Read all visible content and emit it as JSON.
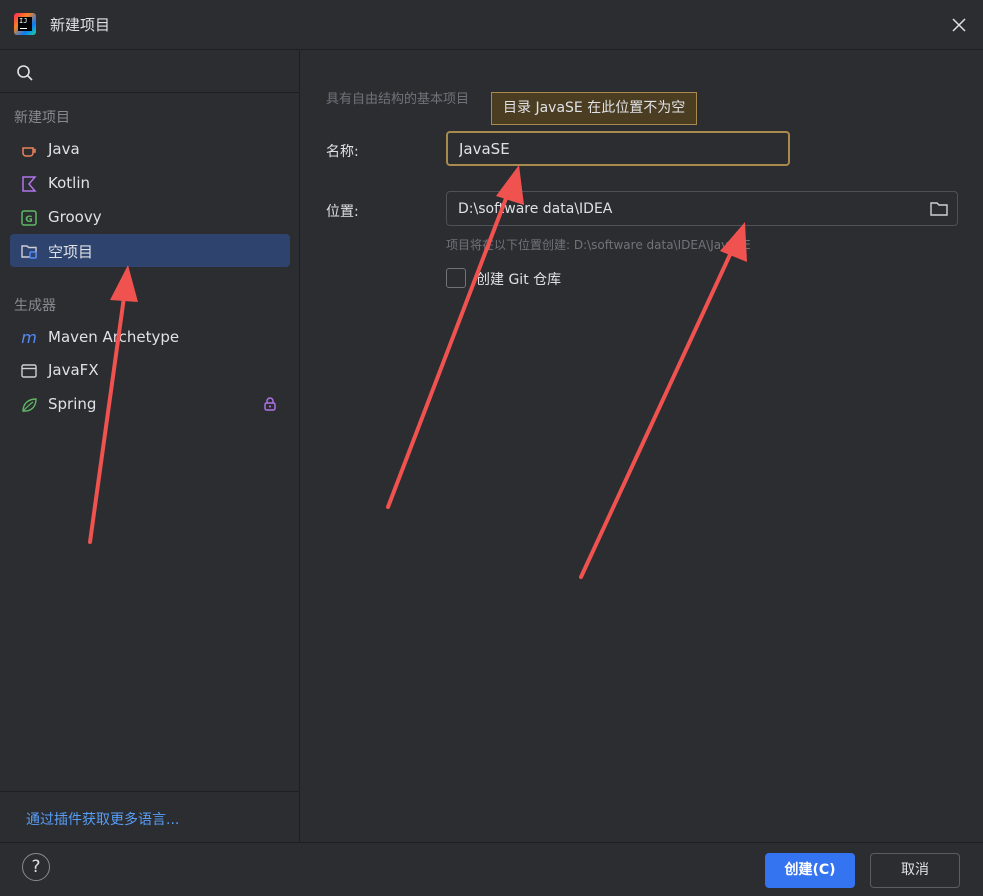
{
  "window": {
    "title": "新建项目",
    "logo_text": "IJ"
  },
  "sidebar": {
    "search_placeholder": "",
    "section_new": "新建项目",
    "items": [
      {
        "label": "Java",
        "icon": "java-cup-icon"
      },
      {
        "label": "Kotlin",
        "icon": "kotlin-icon"
      },
      {
        "label": "Groovy",
        "icon": "groovy-icon"
      },
      {
        "label": "空项目",
        "icon": "empty-project-folder-icon",
        "selected": true
      }
    ],
    "section_generators": "生成器",
    "generators": [
      {
        "label": "Maven Archetype",
        "icon": "maven-m-icon"
      },
      {
        "label": "JavaFX",
        "icon": "javafx-window-icon"
      },
      {
        "label": "Spring",
        "icon": "spring-leaf-icon",
        "locked": true
      }
    ],
    "footer_link": "通过插件获取更多语言..."
  },
  "main": {
    "description": "具有自由结构的基本项目",
    "tooltip": "目录 JavaSE 在此位置不为空",
    "name_label": "名称:",
    "name_value": "JavaSE",
    "location_label": "位置:",
    "location_value": "D:\\software data\\IDEA",
    "location_hint": "项目将在以下位置创建: D:\\software data\\IDEA\\JavaSE",
    "git_checkbox_label": "创建 Git 仓库",
    "git_checked": false
  },
  "footer": {
    "help_label": "?",
    "create_label": "创建(C)",
    "cancel_label": "取消"
  },
  "colors": {
    "background": "#2b2d30",
    "selection": "#2e436e",
    "accent": "#3574f0",
    "warning_border": "#a88a4e",
    "link": "#589df6",
    "annotation_arrow": "#f0524f"
  }
}
